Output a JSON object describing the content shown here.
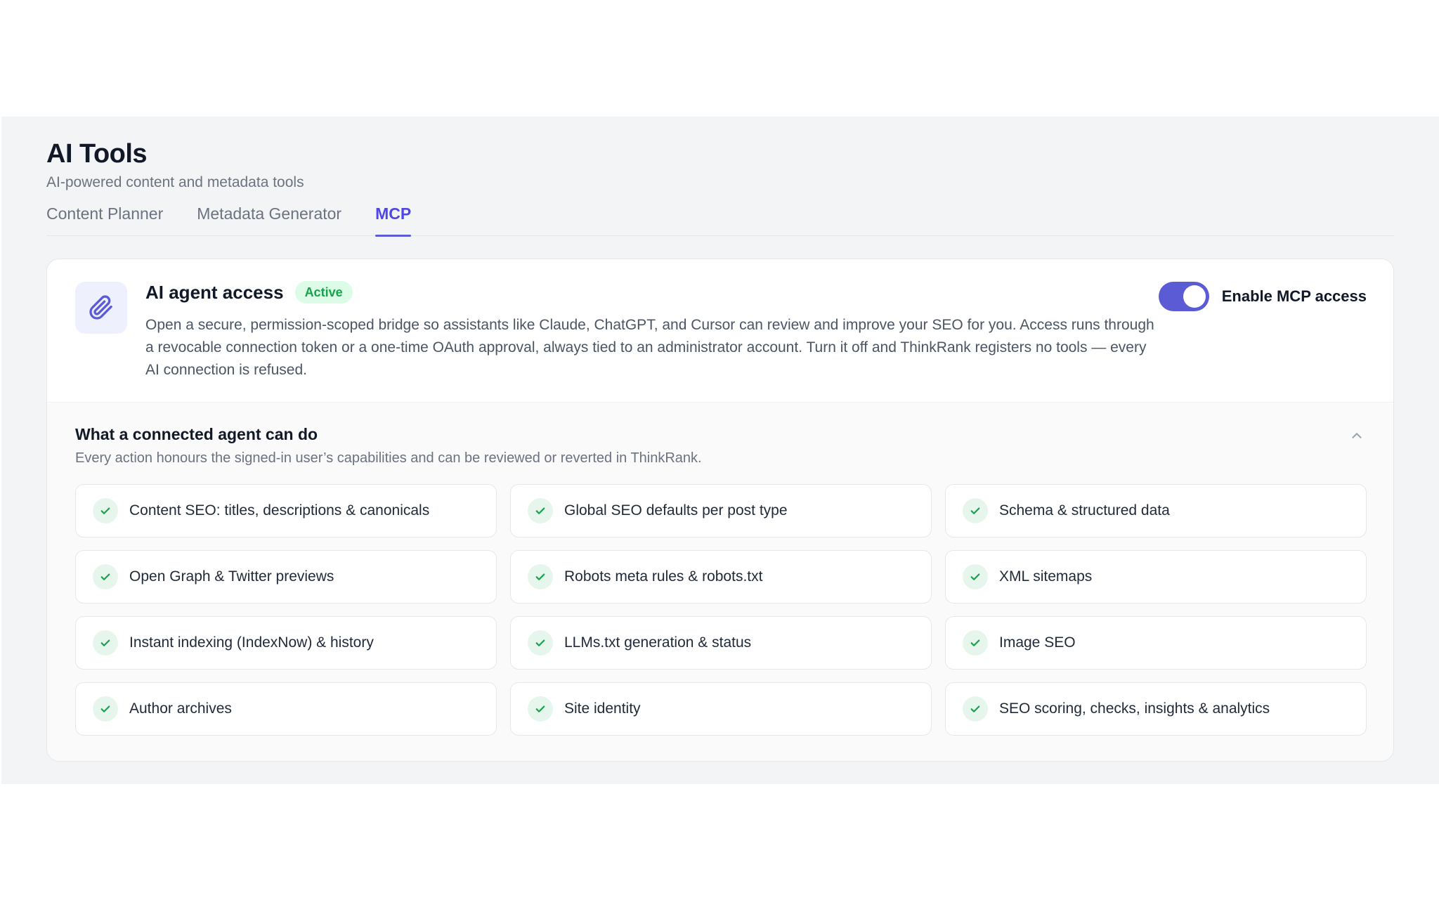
{
  "header": {
    "title": "AI Tools",
    "subtitle": "AI-powered content and metadata tools"
  },
  "tabs": [
    {
      "label": "Content Planner",
      "active": false
    },
    {
      "label": "Metadata Generator",
      "active": false
    },
    {
      "label": "MCP",
      "active": true
    }
  ],
  "agent": {
    "icon": "paperclip-icon",
    "title": "AI agent access",
    "badge": "Active",
    "description": "Open a secure, permission-scoped bridge so assistants like Claude, ChatGPT, and Cursor can review and improve your SEO for you. Access runs through a revocable connection token or a one-time OAuth approval, always tied to an administrator account. Turn it off and ThinkRank registers no tools — every AI connection is refused.",
    "toggle_label": "Enable MCP access",
    "toggle_on": true
  },
  "capabilities": {
    "title": "What a connected agent can do",
    "subtitle": "Every action honours the signed-in user’s capabilities and can be reviewed or reverted in ThinkRank.",
    "items": [
      "Content SEO: titles, descriptions & canonicals",
      "Global SEO defaults per post type",
      "Schema & structured data",
      "Open Graph & Twitter previews",
      "Robots meta rules & robots.txt",
      "XML sitemaps",
      "Instant indexing (IndexNow) & history",
      "LLMs.txt generation & status",
      "Image SEO",
      "Author archives",
      "Site identity",
      "SEO scoring, checks, insights & analytics"
    ]
  },
  "colors": {
    "accent": "#5b5bd6",
    "success": "#16a34a",
    "background": "#f3f4f6"
  }
}
